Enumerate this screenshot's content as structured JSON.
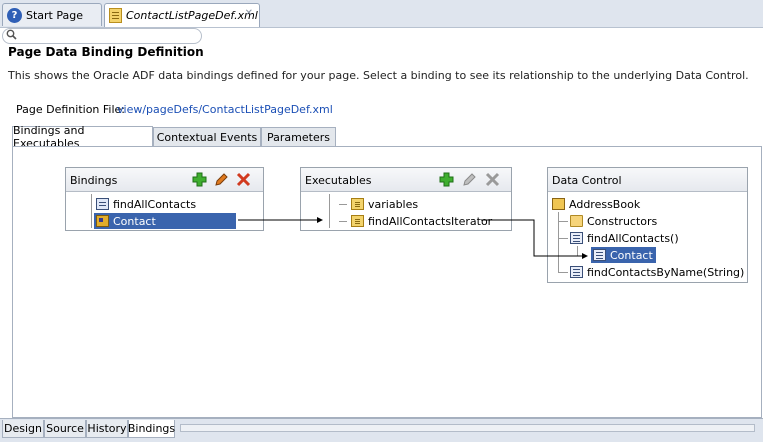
{
  "editor_tabs": {
    "start_page": "Start Page",
    "page_def": "ContactListPageDef.xml"
  },
  "search": {
    "placeholder": ""
  },
  "page": {
    "title": "Page Data Binding Definition",
    "description": "This shows the Oracle ADF data bindings defined for your page. Select a binding to see its relationship to the underlying Data Control.",
    "file_label": "Page Definition File:",
    "file_link": "view/pageDefs/ContactListPageDef.xml"
  },
  "sub_tabs": {
    "bindings": "Bindings and Executables",
    "contextual": "Contextual Events",
    "parameters": "Parameters"
  },
  "bindings_box": {
    "title": "Bindings",
    "items": [
      "findAllContacts",
      "Contact"
    ],
    "selected": "Contact"
  },
  "executables_box": {
    "title": "Executables",
    "items": [
      "variables",
      "findAllContactsIterator"
    ]
  },
  "data_control_box": {
    "title": "Data Control",
    "root": "AddressBook",
    "children": [
      "Constructors",
      "findAllContacts()",
      "Contact",
      "findContactsByName(String)"
    ]
  },
  "bottom_tabs": {
    "design": "Design",
    "source": "Source",
    "history": "History",
    "bindings": "Bindings"
  },
  "colors": {
    "selection": "#3a64ad",
    "link": "#1b4fb5",
    "add": "#2e9a2a",
    "delete": "#d13a1f"
  }
}
